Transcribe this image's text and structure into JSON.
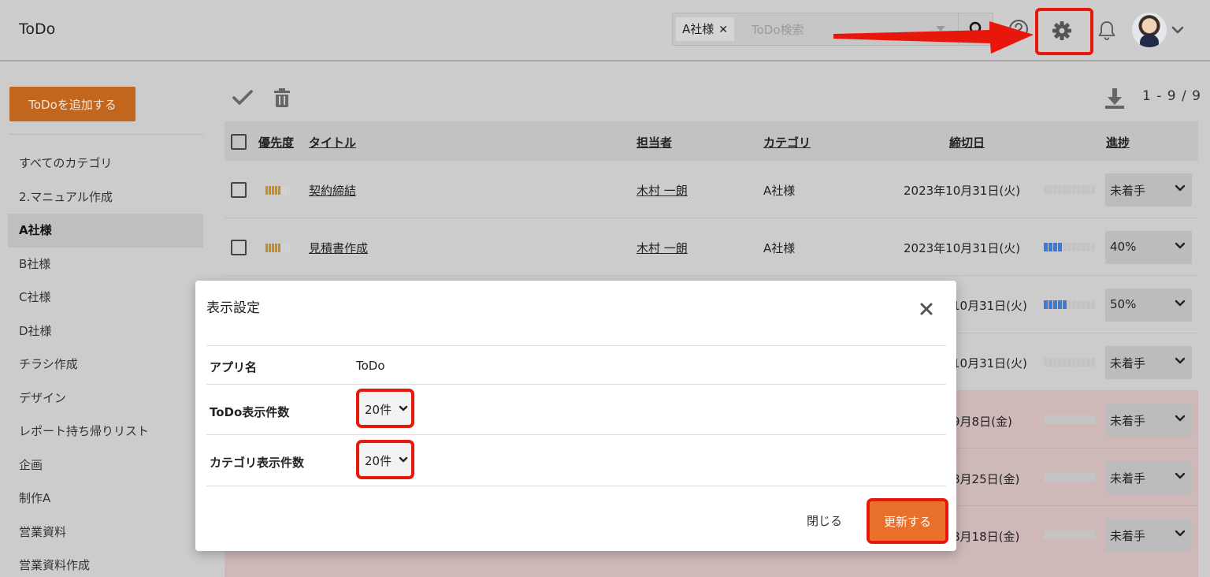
{
  "header": {
    "app_title": "ToDo",
    "search_chip": "A社様",
    "search_chip_remove": "✕",
    "search_placeholder": "ToDo検索",
    "icons": [
      "search-icon",
      "help-icon",
      "gear-icon",
      "bell-icon",
      "avatar",
      "chevron-down-icon"
    ]
  },
  "sidebar": {
    "add_button": "ToDoを追加する",
    "items": [
      {
        "label": "すべてのカテゴリ"
      },
      {
        "label": "2.マニュアル作成"
      },
      {
        "label": "A社様",
        "active": true
      },
      {
        "label": "B社様"
      },
      {
        "label": "C社様"
      },
      {
        "label": "D社様"
      },
      {
        "label": "チラシ作成"
      },
      {
        "label": "デザイン"
      },
      {
        "label": "レポート持ち帰りリスト"
      },
      {
        "label": "企画"
      },
      {
        "label": "制作A"
      },
      {
        "label": "営業資料"
      },
      {
        "label": "営業資料作成"
      }
    ]
  },
  "list": {
    "range": "1 - 9 / 9",
    "columns": {
      "priority": "優先度",
      "title": "タイトル",
      "assignee": "担当者",
      "category": "カテゴリ",
      "due": "締切日",
      "progress": "進捗"
    },
    "rows": [
      {
        "title": "契約締結",
        "assignee": "木村 一朗",
        "category": "A社様",
        "due": "2023年10月31日(火)",
        "status": "未着手",
        "progress": 0
      },
      {
        "title": "見積書作成",
        "assignee": "木村 一朗",
        "category": "A社様",
        "due": "2023年10月31日(火)",
        "status": "40%",
        "progress": 0.4
      },
      {
        "due": "10月31日(火)",
        "status": "50%",
        "progress": 0.5
      },
      {
        "due": "10月31日(火)",
        "status": "未着手",
        "progress": 0
      },
      {
        "due": "9月8日(金)",
        "status": "未着手",
        "progress": 0
      },
      {
        "due": "8月25日(金)",
        "status": "未着手",
        "progress": 0
      },
      {
        "due": "8月18日(金)",
        "status": "未着手",
        "progress": 0
      }
    ]
  },
  "dialog": {
    "title": "表示設定",
    "app_name_label": "アプリ名",
    "app_name_value": "ToDo",
    "todo_count_label": "ToDo表示件数",
    "todo_count_value": "20件",
    "category_count_label": "カテゴリ表示件数",
    "category_count_value": "20件",
    "close_button": "閉じる",
    "update_button": "更新する"
  },
  "colors": {
    "accent_orange": "#e8702a",
    "annotation_red": "#e8170b",
    "priority_gold": "#c98c1f",
    "progress_blue": "#3d7ad8"
  }
}
